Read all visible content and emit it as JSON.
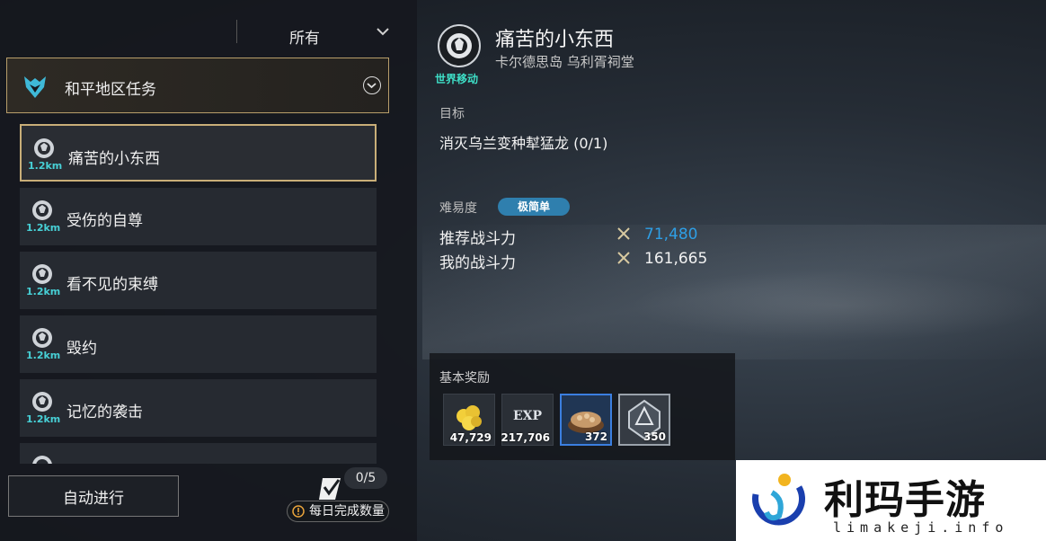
{
  "filter": {
    "selected": "所有"
  },
  "region": {
    "label": "和平地区任务"
  },
  "quests": [
    {
      "label": "痛苦的小东西",
      "distance": "1.2km",
      "selected": true
    },
    {
      "label": "受伤的自尊",
      "distance": "1.2km",
      "selected": false
    },
    {
      "label": "看不见的束缚",
      "distance": "1.2km",
      "selected": false
    },
    {
      "label": "毁约",
      "distance": "1.2km",
      "selected": false
    },
    {
      "label": "记忆的袭击",
      "distance": "1.2km",
      "selected": false
    }
  ],
  "footer": {
    "auto_button": "自动进行",
    "daily_count": "0/5",
    "daily_label": "每日完成数量"
  },
  "detail": {
    "type_label": "世界移动",
    "title": "痛苦的小东西",
    "location": "卡尔德思岛 乌利胥祠堂",
    "objective_heading": "目标",
    "objective": "消灭乌兰变种犎猛龙  (0/1)",
    "difficulty_heading": "难易度",
    "difficulty": "极简单",
    "recommended_power_label": "推荐战斗力",
    "recommended_power": "71,480",
    "my_power_label": "我的战斗力",
    "my_power": "161,665"
  },
  "rewards": {
    "title": "基本奖励",
    "items": [
      {
        "icon": "gold-coins-icon",
        "quantity": "47,729"
      },
      {
        "icon": "exp-icon",
        "label": "EXP",
        "quantity": "217,706"
      },
      {
        "icon": "seeds-bowl-icon",
        "quantity": "372"
      },
      {
        "icon": "crystal-icon",
        "quantity": "350"
      }
    ]
  },
  "watermark": {
    "text": "利玛手游",
    "url": "limakeji.info"
  },
  "colors": {
    "accent_gold": "#c9ae78",
    "distance_teal": "#47d0d6",
    "recommended_blue": "#2e9fe6",
    "difficulty_badge": "#2f7fae"
  }
}
